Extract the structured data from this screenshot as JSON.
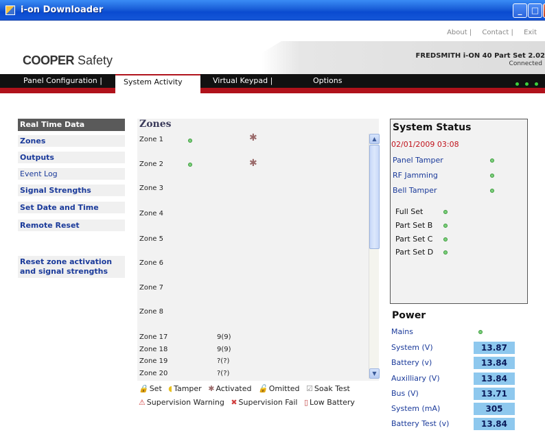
{
  "window": {
    "title": "i-on Downloader"
  },
  "toplinks": [
    "About |",
    "Contact |",
    "Exit"
  ],
  "brand": {
    "logo_bold": "COOPER",
    "logo_rest": " Safety"
  },
  "panel": {
    "name": "FREDSMITH i-ON 40 Part Set 2.02",
    "connection": "Connected"
  },
  "nav": {
    "items": [
      "Panel Configuration |",
      "System Activity",
      "Virtual Keypad |",
      "Options"
    ],
    "active": "System Activity"
  },
  "sidebar": {
    "heading": "Real Time Data",
    "items": [
      "Zones",
      "Outputs",
      "Event Log",
      "Signal Strengths",
      "Set Date and Time",
      "Remote Reset",
      "Reset zone activation and signal strengths"
    ]
  },
  "zones": {
    "title": "Zones",
    "rows": [
      {
        "name": "Zone 1",
        "signal": ""
      },
      {
        "name": "Zone 2",
        "signal": ""
      },
      {
        "name": "Zone 3",
        "signal": ""
      },
      {
        "name": "Zone 4",
        "signal": ""
      },
      {
        "name": "Zone 5",
        "signal": ""
      },
      {
        "name": "Zone 6",
        "signal": ""
      },
      {
        "name": "Zone 7",
        "signal": ""
      },
      {
        "name": "Zone 8",
        "signal": ""
      },
      {
        "name": "Zone 17",
        "signal": "9(9)"
      },
      {
        "name": "Zone 18",
        "signal": "9(9)"
      },
      {
        "name": "Zone 19",
        "signal": "?(?)"
      },
      {
        "name": "Zone 20",
        "signal": "?(?)"
      }
    ]
  },
  "legend": {
    "row1": [
      "Set",
      "Tamper",
      "Activated",
      "Omitted",
      "Soak Test"
    ],
    "row2": [
      "Supervision Warning",
      "Supervision Fail",
      "Low Battery"
    ]
  },
  "status": {
    "title": "System Status",
    "datetime": "02/01/2009 03:08",
    "tampers": [
      "Panel Tamper",
      "RF Jamming",
      "Bell Tamper"
    ],
    "sets": [
      "Full Set",
      "Part Set B",
      "Part Set C",
      "Part Set D"
    ]
  },
  "power": {
    "title": "Power",
    "mains_label": "Mains",
    "readings": [
      {
        "label": "System (V)",
        "value": "13.87"
      },
      {
        "label": "Battery (v)",
        "value": "13.84"
      },
      {
        "label": "Auxilliary (V)",
        "value": "13.84"
      },
      {
        "label": "Bus (V)",
        "value": "13.71"
      },
      {
        "label": "System (mA)",
        "value": "305"
      },
      {
        "label": "Battery Test (v)",
        "value": "13.84"
      }
    ]
  },
  "colors": {
    "accent_red": "#b0121b",
    "link_blue": "#1a3a9a",
    "led_green": "#3bd03b",
    "value_bg": "#8ec8ee"
  }
}
